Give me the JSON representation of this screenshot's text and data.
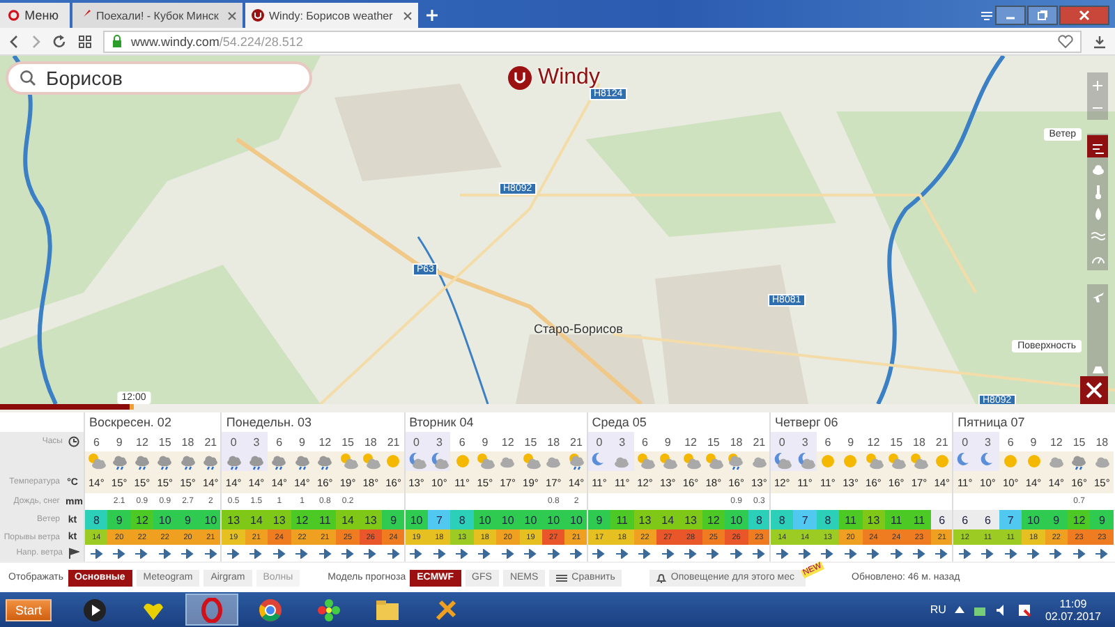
{
  "browser": {
    "menu": "Меню",
    "tabs": [
      {
        "title": "Поехали! - Кубок Минск",
        "selected": false
      },
      {
        "title": "Windy: Борисов weather",
        "selected": true
      }
    ],
    "url_host": "www.windy.com",
    "url_path": "/54.224/28.512"
  },
  "map": {
    "search": {
      "value": "Борисов"
    },
    "logo": "Windy",
    "road_signs": [
      "Н8124",
      "Н8092",
      "Р63",
      "Н8081",
      "Н8092"
    ],
    "place": "Старо-Борисов",
    "layers": [
      {
        "kind": "wind",
        "selected": true
      },
      {
        "kind": "cloud",
        "selected": false
      },
      {
        "kind": "temperature",
        "selected": false
      },
      {
        "kind": "rain",
        "selected": false
      },
      {
        "kind": "waves",
        "selected": false
      },
      {
        "kind": "pressure",
        "selected": false
      }
    ],
    "active_layer_label": "Ветер",
    "level_label": "Поверхность"
  },
  "timeline": {
    "level": 0.12,
    "time": "12:00"
  },
  "forecast": {
    "row_labels": [
      {
        "kind": "hours",
        "label": "Часы"
      },
      {
        "kind": "temp",
        "label": "Температура",
        "unit": "°C"
      },
      {
        "kind": "rain",
        "label": "Дождь, снег",
        "unit": "mm"
      },
      {
        "kind": "wind",
        "label": "Ветер",
        "unit": "kt"
      },
      {
        "kind": "gust",
        "label": "Порывы ветра",
        "unit": "kt"
      },
      {
        "kind": "dir",
        "label": "Напр. ветра"
      }
    ],
    "days": [
      {
        "label": "Воскресен. 02",
        "columns": [
          {
            "hour": "6",
            "night": false,
            "kind": "partly",
            "temp": "14°",
            "wind": "8",
            "gust": "14"
          },
          {
            "hour": "9",
            "night": false,
            "kind": "rain",
            "temp": "15°",
            "rain": "2.1",
            "wind": "9",
            "gust": "20"
          },
          {
            "hour": "12",
            "night": false,
            "kind": "rain",
            "temp": "15°",
            "rain": "0.9",
            "wind": "12",
            "gust": "22"
          },
          {
            "hour": "15",
            "night": false,
            "kind": "rain",
            "temp": "15°",
            "rain": "0.9",
            "wind": "10",
            "gust": "22"
          },
          {
            "hour": "18",
            "night": false,
            "kind": "rain",
            "temp": "15°",
            "rain": "2.7",
            "wind": "9",
            "gust": "20"
          },
          {
            "hour": "21",
            "night": false,
            "kind": "rain",
            "temp": "14°",
            "rain": "2",
            "wind": "10",
            "gust": "21"
          }
        ]
      },
      {
        "label": "Понедельн. 03",
        "columns": [
          {
            "hour": "0",
            "night": true,
            "kind": "rain",
            "temp": "14°",
            "rain": "0.5",
            "wind": "13",
            "gust": "19"
          },
          {
            "hour": "3",
            "night": true,
            "kind": "rain",
            "temp": "14°",
            "rain": "1.5",
            "wind": "14",
            "gust": "21"
          },
          {
            "hour": "6",
            "night": false,
            "kind": "rain",
            "temp": "14°",
            "rain": "1",
            "wind": "13",
            "gust": "24"
          },
          {
            "hour": "9",
            "night": false,
            "kind": "rain",
            "temp": "14°",
            "rain": "1",
            "wind": "12",
            "gust": "22"
          },
          {
            "hour": "12",
            "night": false,
            "kind": "rain",
            "temp": "16°",
            "rain": "0.8",
            "wind": "11",
            "gust": "21"
          },
          {
            "hour": "15",
            "night": false,
            "kind": "partly",
            "temp": "19°",
            "rain": "0.2",
            "wind": "14",
            "gust": "25"
          },
          {
            "hour": "18",
            "night": false,
            "kind": "partly",
            "temp": "18°",
            "wind": "13",
            "gust": "26"
          },
          {
            "hour": "21",
            "night": false,
            "kind": "sun",
            "temp": "16°",
            "wind": "9",
            "gust": "24"
          }
        ]
      },
      {
        "label": "Вторник 04",
        "columns": [
          {
            "hour": "0",
            "night": true,
            "kind": "moon-cloud",
            "temp": "13°",
            "wind": "10",
            "gust": "19"
          },
          {
            "hour": "3",
            "night": true,
            "kind": "moon-cloud",
            "temp": "10°",
            "wind": "7",
            "gust": "18"
          },
          {
            "hour": "6",
            "night": false,
            "kind": "sun",
            "temp": "11°",
            "wind": "8",
            "gust": "13"
          },
          {
            "hour": "9",
            "night": false,
            "kind": "partly",
            "temp": "15°",
            "wind": "10",
            "gust": "18"
          },
          {
            "hour": "12",
            "night": false,
            "kind": "cloud",
            "temp": "17°",
            "wind": "10",
            "gust": "20"
          },
          {
            "hour": "15",
            "night": false,
            "kind": "partly",
            "temp": "19°",
            "wind": "10",
            "gust": "19"
          },
          {
            "hour": "18",
            "night": false,
            "kind": "cloud",
            "temp": "17°",
            "rain": "0.8",
            "wind": "10",
            "gust": "27"
          },
          {
            "hour": "21",
            "night": false,
            "kind": "partly-rain",
            "temp": "14°",
            "rain": "2",
            "wind": "10",
            "gust": "21"
          }
        ]
      },
      {
        "label": "Среда 05",
        "columns": [
          {
            "hour": "0",
            "night": true,
            "kind": "moon",
            "temp": "11°",
            "wind": "9",
            "gust": "17"
          },
          {
            "hour": "3",
            "night": true,
            "kind": "cloud",
            "temp": "11°",
            "wind": "11",
            "gust": "18"
          },
          {
            "hour": "6",
            "night": false,
            "kind": "partly",
            "temp": "12°",
            "wind": "13",
            "gust": "22"
          },
          {
            "hour": "9",
            "night": false,
            "kind": "partly",
            "temp": "13°",
            "wind": "14",
            "gust": "27"
          },
          {
            "hour": "12",
            "night": false,
            "kind": "partly",
            "temp": "16°",
            "wind": "13",
            "gust": "28"
          },
          {
            "hour": "15",
            "night": false,
            "kind": "partly",
            "temp": "18°",
            "wind": "12",
            "gust": "25"
          },
          {
            "hour": "18",
            "night": false,
            "kind": "partly-rain",
            "temp": "16°",
            "rain": "0.9",
            "wind": "10",
            "gust": "26"
          },
          {
            "hour": "21",
            "night": false,
            "kind": "cloud",
            "temp": "13°",
            "rain": "0.3",
            "wind": "8",
            "gust": "23"
          }
        ]
      },
      {
        "label": "Четверг 06",
        "columns": [
          {
            "hour": "0",
            "night": true,
            "kind": "moon-cloud",
            "temp": "12°",
            "wind": "8",
            "gust": "14"
          },
          {
            "hour": "3",
            "night": true,
            "kind": "moon-cloud",
            "temp": "11°",
            "wind": "7",
            "gust": "14"
          },
          {
            "hour": "6",
            "night": false,
            "kind": "sun",
            "temp": "11°",
            "wind": "8",
            "gust": "13"
          },
          {
            "hour": "9",
            "night": false,
            "kind": "sun",
            "temp": "13°",
            "wind": "11",
            "gust": "20"
          },
          {
            "hour": "12",
            "night": false,
            "kind": "partly",
            "temp": "16°",
            "wind": "13",
            "gust": "24"
          },
          {
            "hour": "15",
            "night": false,
            "kind": "partly",
            "temp": "16°",
            "wind": "11",
            "gust": "24"
          },
          {
            "hour": "18",
            "night": false,
            "kind": "partly",
            "temp": "17°",
            "wind": "11",
            "gust": "23"
          },
          {
            "hour": "21",
            "night": false,
            "kind": "sun",
            "temp": "14°",
            "wind": "6",
            "gust": "21"
          }
        ]
      },
      {
        "label": "Пятница 07",
        "columns": [
          {
            "hour": "0",
            "night": true,
            "kind": "moon",
            "temp": "11°",
            "wind": "6",
            "gust": "12"
          },
          {
            "hour": "3",
            "night": true,
            "kind": "moon",
            "temp": "10°",
            "wind": "6",
            "gust": "11"
          },
          {
            "hour": "6",
            "night": false,
            "kind": "sun",
            "temp": "10°",
            "wind": "7",
            "gust": "11"
          },
          {
            "hour": "9",
            "night": false,
            "kind": "sun",
            "temp": "14°",
            "wind": "10",
            "gust": "18"
          },
          {
            "hour": "12",
            "night": false,
            "kind": "cloud",
            "temp": "14°",
            "wind": "9",
            "gust": "22"
          },
          {
            "hour": "15",
            "night": false,
            "kind": "rain",
            "temp": "16°",
            "rain": "0.7",
            "wind": "12",
            "gust": "23"
          },
          {
            "hour": "18",
            "night": false,
            "kind": "cloud",
            "temp": "15°",
            "wind": "9",
            "gust": "23"
          }
        ]
      }
    ]
  },
  "bottom_bar": {
    "display_label": "Отображать",
    "display_options": [
      {
        "label": "Основные",
        "selected": true,
        "disabled": false
      },
      {
        "label": "Meteogram",
        "selected": false,
        "disabled": false
      },
      {
        "label": "Airgram",
        "selected": false,
        "disabled": false
      },
      {
        "label": "Волны",
        "selected": false,
        "disabled": true
      }
    ],
    "model_label": "Модель прогноза",
    "models": [
      {
        "label": "ECMWF",
        "selected": true
      },
      {
        "label": "GFS",
        "selected": false
      },
      {
        "label": "NEMS",
        "selected": false
      }
    ],
    "compare": "Сравнить",
    "alert": "Оповещение для этого мес",
    "new_badge": "NEW",
    "updated": "Обновлено: 46 м. назад"
  },
  "taskbar": {
    "start": "Start",
    "apps": [
      {
        "kind": "media",
        "selected": false
      },
      {
        "kind": "heart",
        "selected": false
      },
      {
        "kind": "opera",
        "selected": true
      },
      {
        "kind": "chrome",
        "selected": false
      },
      {
        "kind": "flower",
        "selected": false
      },
      {
        "kind": "folder",
        "selected": false
      },
      {
        "kind": "tool",
        "selected": false
      }
    ],
    "language": "RU",
    "time": "11:09",
    "date": "02.07.2017"
  }
}
